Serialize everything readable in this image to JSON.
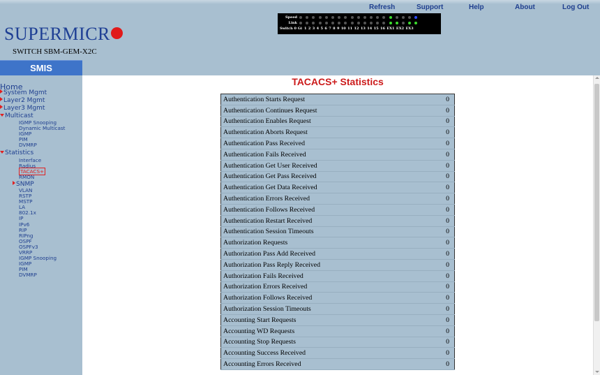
{
  "header": {
    "links": [
      "Refresh",
      "Support",
      "Help",
      "About",
      "Log Out"
    ],
    "logo_text": "SUPERMICR",
    "switch_model": "SWITCH SBM-GEM-X2C"
  },
  "led_panel": {
    "speed_label": "Speed",
    "link_label": "Link",
    "port_label": "Switch 0 Gi",
    "ports": [
      "1",
      "2",
      "3",
      "4",
      "5",
      "6",
      "7",
      "8",
      "9",
      "10",
      "11",
      "12",
      "13",
      "14",
      "15",
      "16",
      "EX1",
      "EX2",
      "EX3"
    ],
    "speed_colors": [
      "gray",
      "gray",
      "gray",
      "gray",
      "gray",
      "gray",
      "gray",
      "gray",
      "gray",
      "gray",
      "gray",
      "gray",
      "gray",
      "gray",
      "green",
      "gray",
      "gray",
      "gray",
      "blue"
    ],
    "link_colors": [
      "gray",
      "gray",
      "gray",
      "gray",
      "gray",
      "gray",
      "gray",
      "gray",
      "gray",
      "gray",
      "gray",
      "gray",
      "gray",
      "gray",
      "green",
      "green",
      "gray",
      "green",
      "green"
    ]
  },
  "sidebar": {
    "title": "SMIS",
    "home": "Home",
    "items": [
      {
        "label": "System Mgmt",
        "marker": "right"
      },
      {
        "label": "Layer2 Mgmt",
        "marker": "right"
      },
      {
        "label": "Layer3 Mgmt",
        "marker": "right"
      },
      {
        "label": "Multicast",
        "marker": "down"
      },
      {
        "label": "Statistics",
        "marker": "down"
      }
    ],
    "multicast_items": [
      "IGMP Snooping",
      "Dynamic Multicast",
      "IGMP",
      "PIM",
      "DVMRP"
    ],
    "statistics_items": [
      "Interface",
      "Radius",
      "TACACS+",
      "RMON",
      "SNMP",
      "VLAN",
      "RSTP",
      "MSTP",
      "LA",
      "802.1x",
      "IP",
      "IPv6",
      "RIP",
      "RIPng",
      "OSPF",
      "OSPFv3",
      "VRRP",
      "IGMP Snooping",
      "IGMP",
      "PIM",
      "DVMRP"
    ],
    "active_item": "TACACS+"
  },
  "main": {
    "title": "TACACS+ Statistics",
    "rows": [
      {
        "label": "Authentication Starts Request",
        "value": "0"
      },
      {
        "label": "Authentication Continues Request",
        "value": "0"
      },
      {
        "label": "Authentication Enables Request",
        "value": "0"
      },
      {
        "label": "Authentication Aborts Request",
        "value": "0"
      },
      {
        "label": "Authentication Pass Received",
        "value": "0"
      },
      {
        "label": "Authentication Fails Received",
        "value": "0"
      },
      {
        "label": "Authentication Get User Received",
        "value": "0"
      },
      {
        "label": "Authentication Get Pass Received",
        "value": "0"
      },
      {
        "label": "Authentication Get Data Received",
        "value": "0"
      },
      {
        "label": "Authentication Errors Received",
        "value": "0"
      },
      {
        "label": "Authentication Follows Received",
        "value": "0"
      },
      {
        "label": "Authentication Restart Received",
        "value": "0"
      },
      {
        "label": "Authentication Session Timeouts",
        "value": "0"
      },
      {
        "label": "Authorization Requests",
        "value": "0"
      },
      {
        "label": "Authorization Pass Add Received",
        "value": "0"
      },
      {
        "label": "Authorization Pass Reply Received",
        "value": "0"
      },
      {
        "label": "Authorization Fails Received",
        "value": "0"
      },
      {
        "label": "Authorization Errors Received",
        "value": "0"
      },
      {
        "label": "Authorization Follows Received",
        "value": "0"
      },
      {
        "label": "Authorization Session Timeouts",
        "value": "0"
      },
      {
        "label": "Accounting Start Requests",
        "value": "0"
      },
      {
        "label": "Accounting WD Requests",
        "value": "0"
      },
      {
        "label": "Accounting Stop Requests",
        "value": "0"
      },
      {
        "label": "Accounting Success Received",
        "value": "0"
      },
      {
        "label": "Accounting Errors Received",
        "value": "0"
      }
    ]
  },
  "colors": {
    "link_blue": "#1f3f8f",
    "title_red": "#cc1b1b",
    "panel_bg": "#a8bfd0",
    "smis_blue": "#3e74c9",
    "logo_red": "#e11a1a"
  }
}
